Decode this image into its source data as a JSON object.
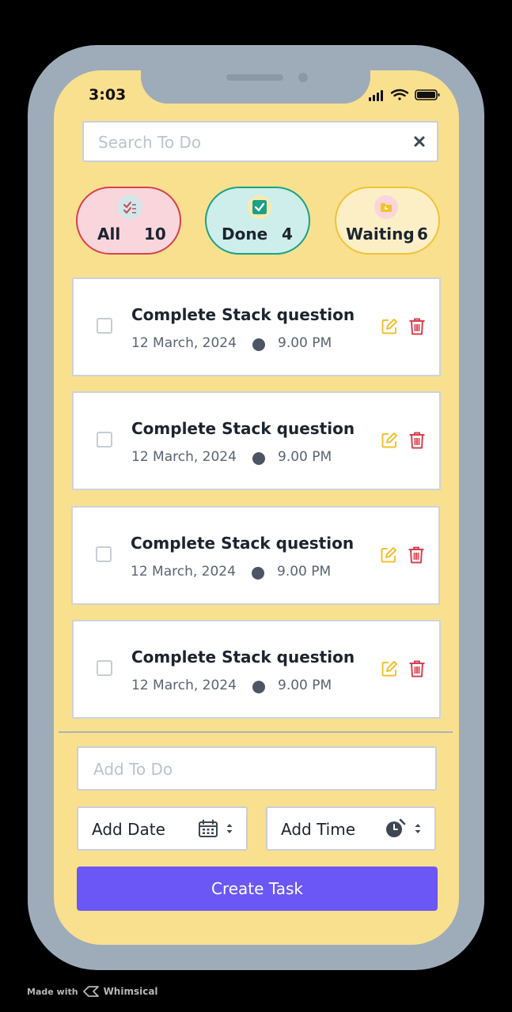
{
  "status_bar": {
    "time": "3:03"
  },
  "search": {
    "placeholder": "Search To Do"
  },
  "filters": [
    {
      "label": "All",
      "count": "10",
      "icon": "checklist-icon"
    },
    {
      "label": "Done",
      "count": "4",
      "icon": "check-box-icon"
    },
    {
      "label": "Waiting",
      "count": "6",
      "icon": "folder-clock-icon"
    }
  ],
  "tasks": [
    {
      "title": "Complete Stack question",
      "date": "12 March, 2024",
      "time": "9.00 PM"
    },
    {
      "title": "Complete Stack question",
      "date": "12 March, 2024",
      "time": "9.00 PM"
    },
    {
      "title": "Complete Stack question",
      "date": "12 March, 2024",
      "time": "9.00 PM"
    },
    {
      "title": "Complete Stack question",
      "date": "12 March, 2024",
      "time": "9.00 PM"
    }
  ],
  "add_form": {
    "todo_placeholder": "Add To Do",
    "date_label": "Add Date",
    "time_label": "Add Time",
    "create_label": "Create Task"
  },
  "footer": {
    "made_with": "Made with",
    "brand": "Whimsical"
  },
  "colors": {
    "background": "#f9e08f",
    "frame": "#9eacb9",
    "accent": "#6b57f5",
    "all_border": "#d8404f",
    "done_border": "#1aa187",
    "waiting_border": "#f0c235",
    "edit": "#f2c12e",
    "delete": "#d8404f"
  }
}
